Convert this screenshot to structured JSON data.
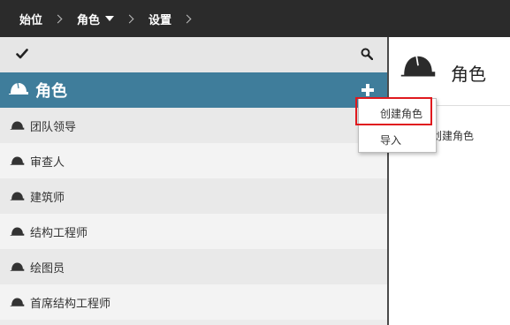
{
  "breadcrumb": {
    "items": [
      "始位",
      "角色",
      "设置"
    ]
  },
  "section": {
    "title": "角色"
  },
  "roles": [
    {
      "label": "团队领导"
    },
    {
      "label": "审查人"
    },
    {
      "label": "建筑师"
    },
    {
      "label": "结构工程师"
    },
    {
      "label": "绘图员"
    },
    {
      "label": "首席结构工程师"
    }
  ],
  "right_panel": {
    "title": "角色",
    "text": "创建角色"
  },
  "dropdown_menu": {
    "create_label": "创建角色",
    "import_label": "导入"
  },
  "icons": {
    "role": "hard-hat-icon",
    "toolbar_left": "checkmark-icon",
    "toolbar_right": "search-icon",
    "add": "plus-icon",
    "breadcrumb_dropdown": "caret-down-icon"
  },
  "colors": {
    "topbar": "#2b2b2b",
    "section_header": "#3f7d9b",
    "highlight": "#e0191e"
  }
}
